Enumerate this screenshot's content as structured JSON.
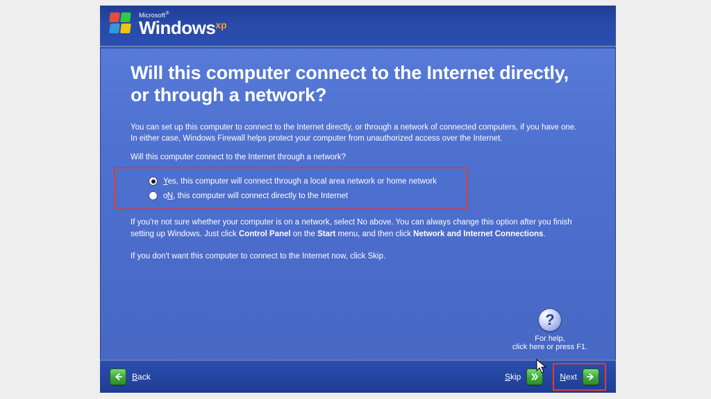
{
  "logo": {
    "microsoft": "Microsoft",
    "reg": "®",
    "windows": "Windows",
    "xp": "xp"
  },
  "title": "Will this computer connect to the Internet directly, or through a network?",
  "para1": "You can set up this computer to connect to the Internet directly, or through a network of connected computers, if you have one. In either case, Windows Firewall helps protect your computer from unauthorized access over the Internet.",
  "question": "Will this computer connect to the Internet through a network?",
  "options": [
    {
      "u": "Y",
      "rest": "es, this computer will connect through a local area network or home network",
      "selected": true
    },
    {
      "u": "N",
      "rest_a": "o",
      "rest_b": ", this computer will connect directly to the Internet",
      "selected": false
    }
  ],
  "para2_parts": {
    "a": "If you're not sure whether your computer is on a network, select No above. You can always change this option after you finish setting up Windows. Just click ",
    "b": "Control Panel",
    "c": " on the ",
    "d": "Start",
    "e": " menu, and then click ",
    "f": "Network and Internet Connections",
    "g": "."
  },
  "para3": "If you don't want this computer to connect to the Internet now, click Skip.",
  "help": {
    "q": "?",
    "line1": "For help,",
    "line2": "click here or press F1."
  },
  "nav": {
    "back_u": "B",
    "back_rest": "ack",
    "skip_u": "S",
    "skip_rest": "kip",
    "next_u": "N",
    "next_rest": "ext"
  }
}
